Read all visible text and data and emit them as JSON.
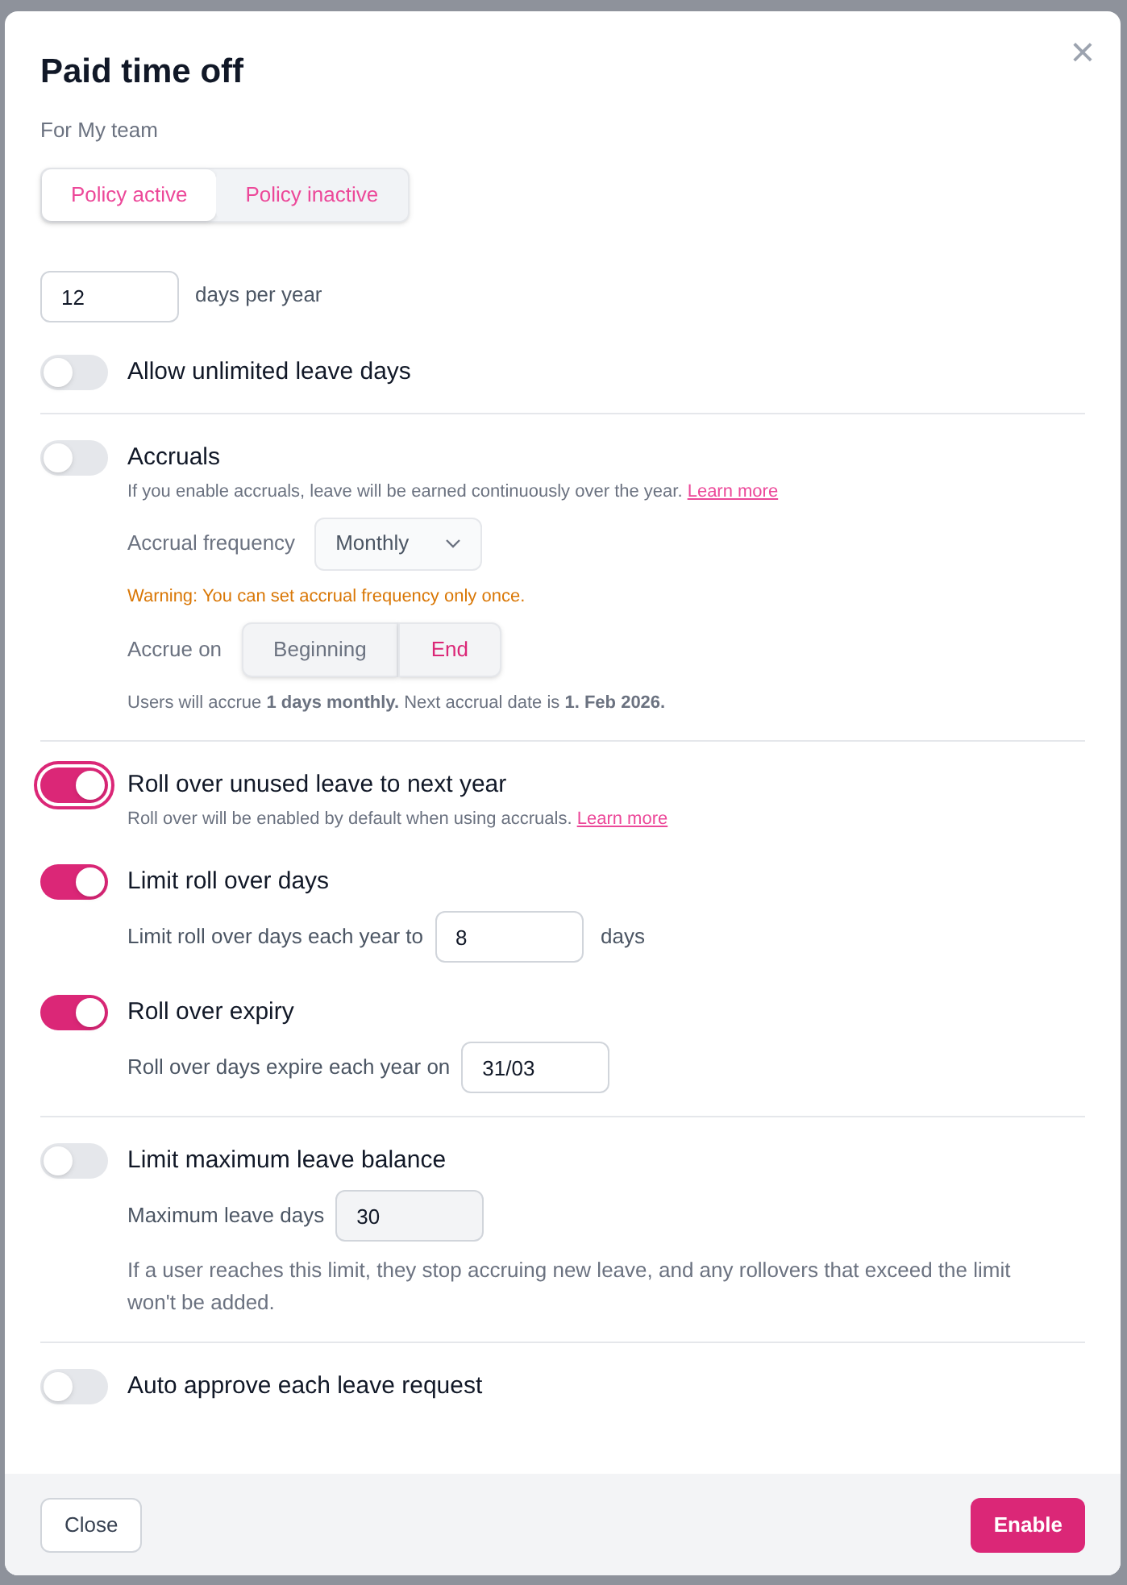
{
  "dialog": {
    "title": "Paid time off",
    "subtitle": "For My team",
    "close_icon": "×"
  },
  "policy_tabs": [
    {
      "label": "Policy active",
      "selected": true
    },
    {
      "label": "Policy inactive",
      "selected": false
    }
  ],
  "groups": [
    {
      "items": [
        {
          "kind": "field",
          "value": "12",
          "suffix": "days per year"
        },
        {
          "kind": "toggle",
          "label": "Allow unlimited leave days",
          "on": false,
          "focused": false
        }
      ]
    },
    {
      "items": [
        {
          "kind": "toggle",
          "label": "Accruals",
          "on": false,
          "focused": false,
          "description": "If you enable accruals, leave will be earned continuously over the year.",
          "link": "Learn more",
          "rows": [
            {
              "kind": "select",
              "label": "Accrual frequency",
              "value": "Monthly"
            },
            {
              "kind": "warning",
              "text": "Warning: You can set accrual frequency only once."
            },
            {
              "kind": "segmented",
              "label": "Accrue on",
              "options": [
                {
                  "label": "Beginning",
                  "selected": false
                },
                {
                  "label": "End",
                  "selected": true
                }
              ]
            },
            {
              "kind": "note",
              "text": "Users will accrue **1 days monthly.** Next accrual date is **1. Feb 2026.**"
            }
          ]
        }
      ]
    },
    {
      "items": [
        {
          "kind": "toggle",
          "label": "Roll over unused leave to next year",
          "on": true,
          "focused": true,
          "description": "Roll over will be enabled by default when using accruals.",
          "link": "Learn more"
        },
        {
          "kind": "toggle",
          "label": "Limit roll over days",
          "on": true,
          "focused": false,
          "rows": [
            {
              "kind": "input",
              "label": "Limit roll over days each year to",
              "value": "8",
              "suffix": "days",
              "disabled": false
            }
          ]
        },
        {
          "kind": "toggle",
          "label": "Roll over expiry",
          "on": true,
          "focused": false,
          "rows": [
            {
              "kind": "input",
              "label": "Roll over days expire each year on",
              "value": "31/03",
              "disabled": false
            }
          ]
        }
      ]
    },
    {
      "items": [
        {
          "kind": "toggle",
          "label": "Limit maximum leave balance",
          "on": false,
          "focused": false,
          "rows": [
            {
              "kind": "input",
              "label": "Maximum leave days",
              "value": "30",
              "disabled": true
            },
            {
              "kind": "paragraph",
              "text": "If a user reaches this limit, they stop accruing new leave, and any rollovers that exceed the limit won't be added."
            }
          ]
        }
      ]
    },
    {
      "items": [
        {
          "kind": "toggle",
          "label": "Auto approve each leave request",
          "on": false,
          "focused": false
        }
      ]
    }
  ],
  "footer": {
    "close": "Close",
    "enable": "Enable"
  }
}
